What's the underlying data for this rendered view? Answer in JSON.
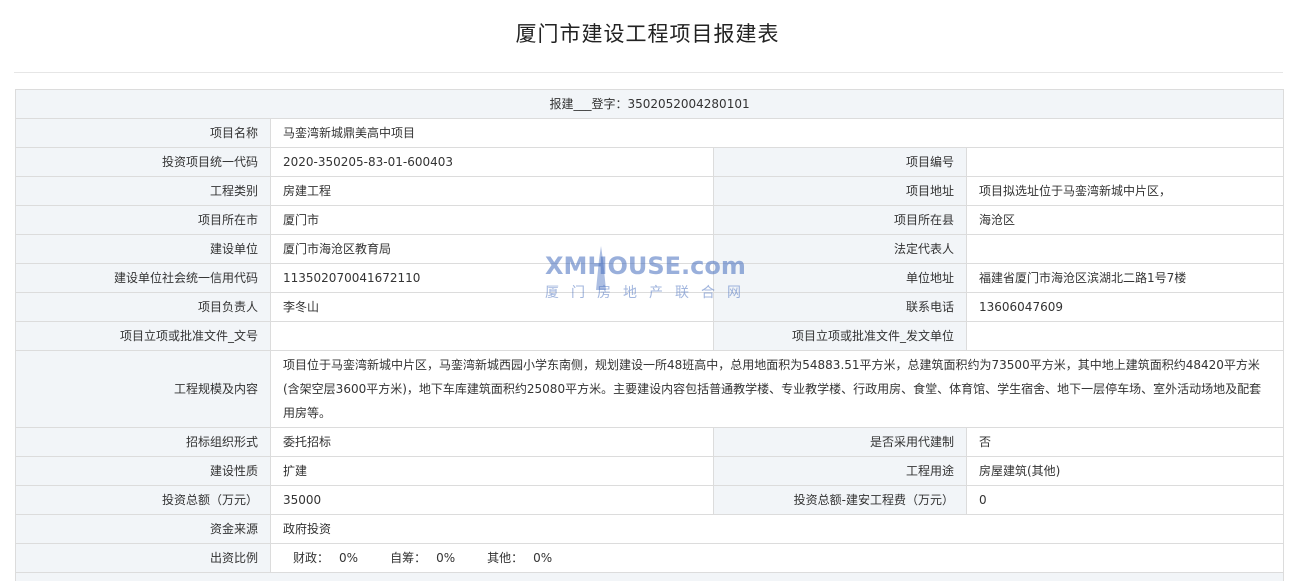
{
  "page_title": "厦门市建设工程项目报建表",
  "header_row": "报建___登字：3502052004280101",
  "rows": {
    "project_name": {
      "label": "项目名称",
      "value": "马銮湾新城鼎美高中项目"
    },
    "invest_code": {
      "label": "投资项目统一代码",
      "value": "2020-350205-83-01-600403"
    },
    "project_no": {
      "label": "项目编号",
      "value": ""
    },
    "project_type": {
      "label": "工程类别",
      "value": "房建工程"
    },
    "project_address": {
      "label": "项目地址",
      "value": "项目拟选址位于马銮湾新城中片区，"
    },
    "city": {
      "label": "项目所在市",
      "value": "厦门市"
    },
    "county": {
      "label": "项目所在县",
      "value": "海沧区"
    },
    "builder": {
      "label": "建设单位",
      "value": "厦门市海沧区教育局"
    },
    "legal_rep": {
      "label": "法定代表人",
      "value": ""
    },
    "credit_code": {
      "label": "建设单位社会统一信用代码",
      "value": "113502070041672110"
    },
    "unit_address": {
      "label": "单位地址",
      "value": "福建省厦门市海沧区滨湖北二路1号7楼"
    },
    "manager": {
      "label": "项目负责人",
      "value": "李冬山"
    },
    "phone": {
      "label": "联系电话",
      "value": "13606047609"
    },
    "approval_doc_no": {
      "label": "项目立项或批准文件_文号",
      "value": ""
    },
    "approval_unit": {
      "label": "项目立项或批准文件_发文单位",
      "value": ""
    },
    "scale": {
      "label": "工程规模及内容",
      "value": "项目位于马銮湾新城中片区，马銮湾新城西园小学东南侧，规划建设一所48班高中，总用地面积为54883.51平方米，总建筑面积约为73500平方米，其中地上建筑面积约48420平方米(含架空层3600平方米)，地下车库建筑面积约25080平方米。主要建设内容包括普通教学楼、专业教学楼、行政用房、食堂、体育馆、学生宿舍、地下一层停车场、室外活动场地及配套用房等。"
    },
    "bid_form": {
      "label": "招标组织形式",
      "value": "委托招标"
    },
    "agent_system": {
      "label": "是否采用代建制",
      "value": "否"
    },
    "nature": {
      "label": "建设性质",
      "value": "扩建"
    },
    "usage": {
      "label": "工程用途",
      "value": "房屋建筑(其他)"
    },
    "total_invest": {
      "label": "投资总额（万元）",
      "value": "35000"
    },
    "install_cost": {
      "label": "投资总额-建安工程费（万元）",
      "value": "0"
    },
    "fund_source": {
      "label": "资金来源",
      "value": "政府投资"
    },
    "ratio": {
      "label": "出资比例",
      "finance_label": "财政：",
      "finance_value": "0%",
      "self_label": "自筹：",
      "self_value": "0%",
      "other_label": "其他：",
      "other_value": "0%"
    }
  },
  "watermark": {
    "logo_text": "XMHOUSE.com",
    "sub_text": "厦门房地产联合网",
    "color": "#466ebe"
  }
}
